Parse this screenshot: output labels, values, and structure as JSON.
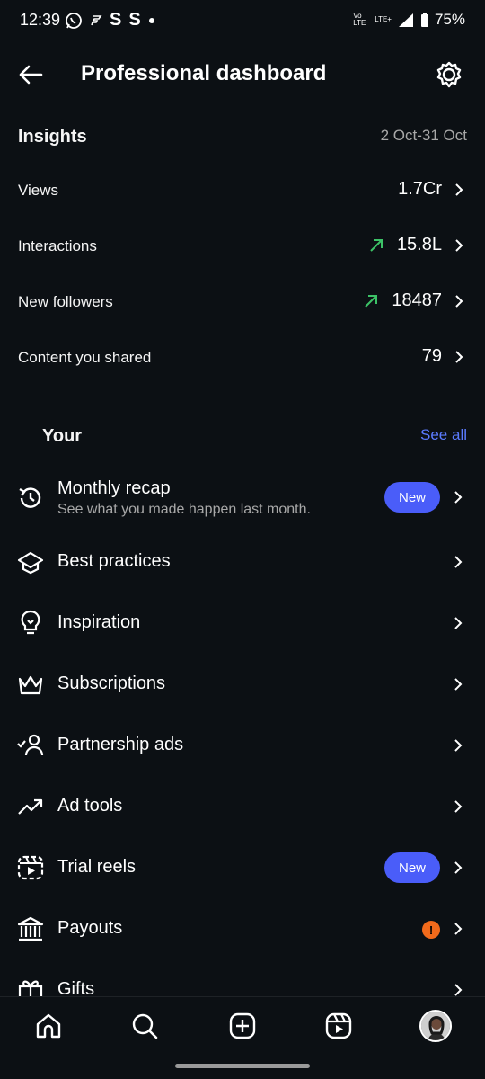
{
  "status_bar": {
    "time": "12:39",
    "letters": [
      "S",
      "S"
    ],
    "network": "LTE+",
    "volte": "Vo LTE",
    "battery": "75%"
  },
  "header": {
    "title": "Professional dashboard"
  },
  "insights": {
    "title": "Insights",
    "date_range": "2 Oct-31 Oct",
    "metrics": [
      {
        "label": "Views",
        "value": "1.7Cr",
        "trend": "none"
      },
      {
        "label": "Interactions",
        "value": "15.8L",
        "trend": "up"
      },
      {
        "label": "New followers",
        "value": "18487",
        "trend": "up"
      },
      {
        "label": "Content you shared",
        "value": "79",
        "trend": "none"
      }
    ]
  },
  "tools": {
    "title": "Your",
    "see_all": "See all",
    "items": [
      {
        "label": "Monthly recap",
        "subtitle": "See what you made happen last month.",
        "icon": "history-icon",
        "badge": "New"
      },
      {
        "label": "Best practices",
        "icon": "graduation-cap-icon"
      },
      {
        "label": "Inspiration",
        "icon": "lightbulb-icon"
      },
      {
        "label": "Subscriptions",
        "icon": "crown-icon"
      },
      {
        "label": "Partnership ads",
        "icon": "person-check-icon"
      },
      {
        "label": "Ad tools",
        "icon": "trending-up-icon"
      },
      {
        "label": "Trial reels",
        "icon": "trial-reels-icon",
        "badge": "New"
      },
      {
        "label": "Payouts",
        "icon": "bank-icon",
        "alert": "!"
      },
      {
        "label": "Gifts",
        "icon": "gift-icon"
      }
    ]
  },
  "colors": {
    "background": "#0c1014",
    "accent": "#4a5df9",
    "link": "#5b7bff",
    "trend_up": "#3cc267",
    "alert": "#f26a1b"
  },
  "bottom_nav": [
    "home-icon",
    "search-icon",
    "create-icon",
    "reels-icon",
    "profile-avatar"
  ]
}
